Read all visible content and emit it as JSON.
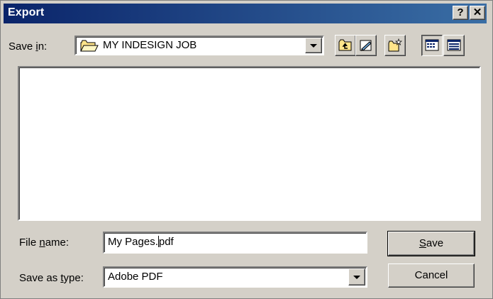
{
  "window": {
    "title": "Export",
    "help_label": "?",
    "close_label": "✕"
  },
  "save_in": {
    "label_pre": "Save ",
    "label_accel": "i",
    "label_post": "n:",
    "value": "MY INDESIGN JOB",
    "icon": "folder-icon"
  },
  "toolbar": {
    "buttons": [
      {
        "name": "up-one-level-icon"
      },
      {
        "name": "look-in-favorites-icon"
      },
      {
        "name": "create-new-folder-icon"
      },
      {
        "name": "list-view-icon",
        "pressed": true
      },
      {
        "name": "details-view-icon"
      }
    ]
  },
  "file_name": {
    "label_pre": "File ",
    "label_accel": "n",
    "label_post": "ame:",
    "value_before_caret": "My Pages.",
    "value_after_caret": "pdf"
  },
  "save_as_type": {
    "label_pre": "Save as ",
    "label_accel": "t",
    "label_post": "ype:",
    "value": "Adobe PDF"
  },
  "buttons": {
    "save_accel": "S",
    "save_rest": "ave",
    "cancel": "Cancel"
  },
  "colors": {
    "titlebar_start": "#0a246a",
    "titlebar_end": "#3a6ea5",
    "face": "#d4d0c8"
  }
}
